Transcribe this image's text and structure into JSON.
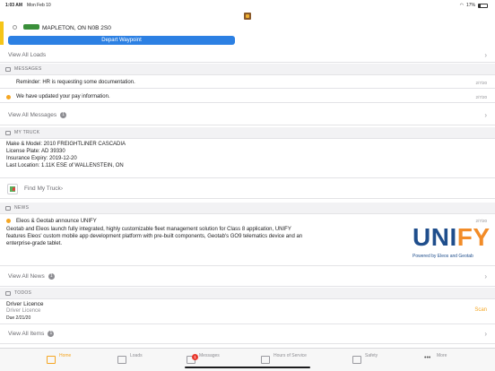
{
  "status_bar": {
    "time": "1:03 AM",
    "date": "Mon Feb 10",
    "battery": "17%"
  },
  "load": {
    "location": "MAPLETON, ON N0B 2S0",
    "depart_label": "Depart Waypoint"
  },
  "view_all_loads": "View All Loads",
  "messages": {
    "header": "MESSAGES",
    "items": [
      {
        "text": "Reminder: HR is requesting some documentation.",
        "date": "2/7/20"
      },
      {
        "text": "We have updated your pay information.",
        "date": "2/7/20"
      }
    ],
    "view_all": "View All Messages",
    "count": "1"
  },
  "truck": {
    "header": "MY TRUCK",
    "lines": [
      "Make & Model: 2010 FREIGHTLINER CASCADIA",
      "License Plate: AD 39330",
      "Insurance Expiry: 2019-12-20",
      "Last Location: 1.11K ESE of WALLENSTEIN, ON"
    ],
    "find": "Find My Truck"
  },
  "news": {
    "header": "NEWS",
    "title": "Eleos & Geotab announce UNIFY",
    "date": "2/7/20",
    "body": "Geotab and Eleos launch fully integrated, highly customizable fleet management solution for Class 8 application, UNIFY features Eleos' custom mobile app development platform with pre-built components, Geotab's GO9 telematics device and an enterprise-grade tablet.",
    "logo_part1": "UNI",
    "logo_part2": "FY",
    "powered_by": "Powered by Eleos and Geotab",
    "view_all": "View All News",
    "count": "1"
  },
  "todos": {
    "header": "TODOS",
    "title": "Driver Licence",
    "subtitle": "Driver Licence",
    "due": "Due 2/21/20",
    "action": "Scan",
    "view_all": "View All Items",
    "count": "1"
  },
  "tabs": [
    {
      "label": "Home",
      "icon": "home-icon"
    },
    {
      "label": "Loads",
      "icon": "truck-icon"
    },
    {
      "label": "Messages",
      "icon": "messages-icon",
      "badge": "1"
    },
    {
      "label": "Hours of Service",
      "icon": "clock-icon"
    },
    {
      "label": "Safety",
      "icon": "warning-icon"
    },
    {
      "label": "More",
      "icon": "more-icon"
    }
  ],
  "colors": {
    "accent": "#f5a623",
    "primary_button": "#2c80e3",
    "load_bar": "#f5c518",
    "unify_blue": "#1f4e8c",
    "unify_orange": "#f28c28"
  }
}
